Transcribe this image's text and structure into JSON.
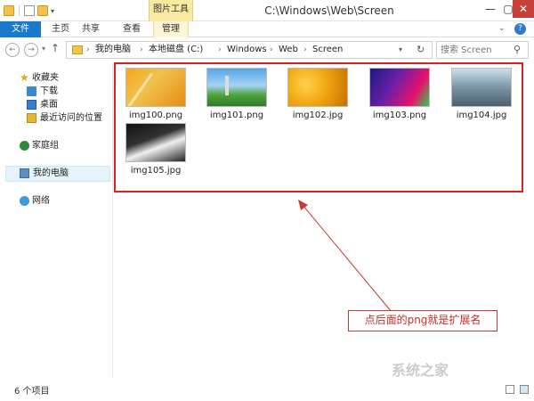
{
  "window": {
    "title": "C:\\Windows\\Web\\Screen",
    "context_tab_header": "图片工具"
  },
  "ribbon": {
    "tabs": [
      {
        "label": "文件"
      },
      {
        "label": "主页"
      },
      {
        "label": "共享"
      },
      {
        "label": "查看"
      },
      {
        "label": "管理"
      }
    ]
  },
  "address": {
    "breadcrumbs": [
      "我的电脑",
      "本地磁盘 (C:)",
      "Windows",
      "Web",
      "Screen"
    ],
    "search_placeholder": "搜索 Screen"
  },
  "sidebar": {
    "items": [
      {
        "label": "收藏夹",
        "icon": "star-icon"
      },
      {
        "label": "下载",
        "icon": "download-folder-icon"
      },
      {
        "label": "桌面",
        "icon": "desktop-icon"
      },
      {
        "label": "最近访问的位置",
        "icon": "recent-places-icon"
      },
      {
        "label": "家庭组",
        "icon": "homegroup-icon"
      },
      {
        "label": "我的电脑",
        "icon": "computer-icon"
      },
      {
        "label": "网络",
        "icon": "network-icon"
      }
    ]
  },
  "files": [
    {
      "name": "img100.png",
      "thumb": "orange-abstract"
    },
    {
      "name": "img101.png",
      "thumb": "space-needle-landscape"
    },
    {
      "name": "img102.jpg",
      "thumb": "honeycomb"
    },
    {
      "name": "img103.png",
      "thumb": "colorful-geometric"
    },
    {
      "name": "img104.jpg",
      "thumb": "motion-blur-street"
    },
    {
      "name": "img105.jpg",
      "thumb": "piano-keys"
    }
  ],
  "annotation": {
    "callout_text": "点后面的png就是扩展名",
    "box_color": "#e0201c",
    "arrow_color": "#c83a34"
  },
  "status": {
    "item_count": "6 个项目"
  },
  "colors": {
    "file_tab": "#1979ca",
    "context_tab": "#f7e9a0",
    "close_button": "#c7413a"
  }
}
